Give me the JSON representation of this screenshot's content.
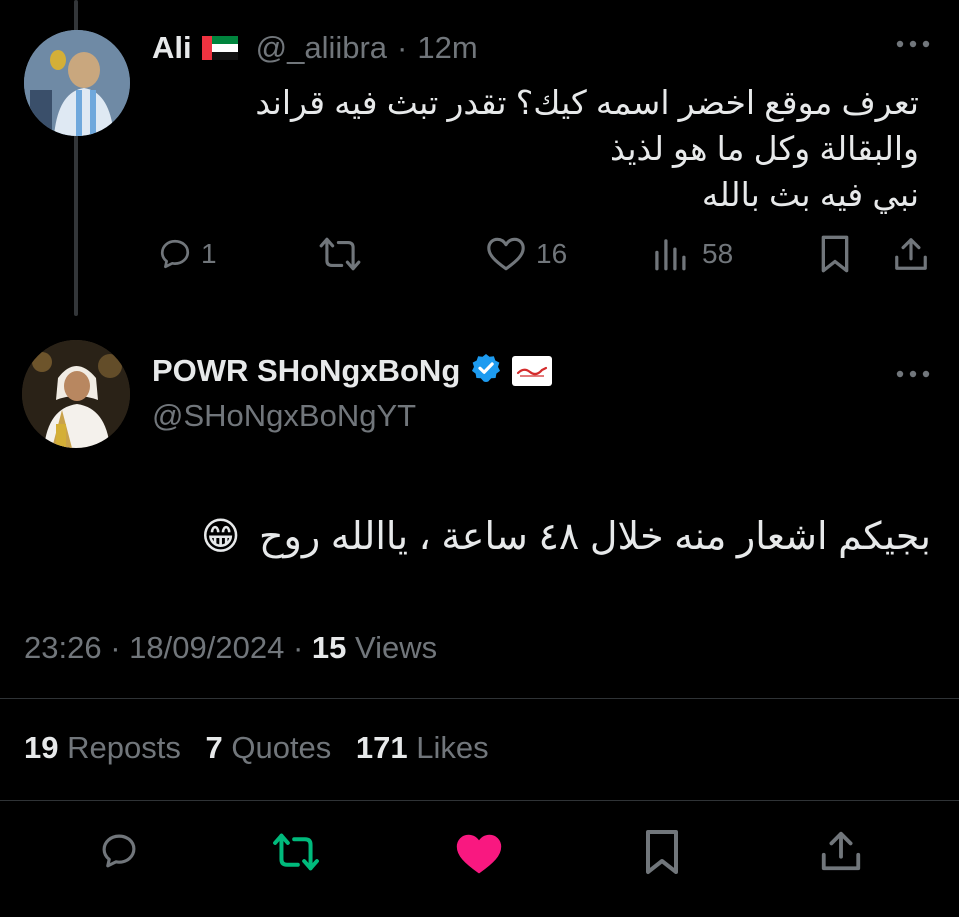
{
  "reply_to_tweet": {
    "display_name": "Ali",
    "flag": "uae-flag-emoji",
    "handle": "@_aliibra",
    "separator": "·",
    "time": "12m",
    "text_lines": [
      "تعرف موقع اخضر اسمه كيك؟ تقدر تبث فيه قراند",
      "والبقالة وكل ما هو لذيذ",
      "نبي فيه بث بالله"
    ],
    "actions": {
      "replies": "1",
      "likes": "16",
      "views": "58"
    }
  },
  "main_tweet": {
    "display_name": "POWR SHoNgxBoNg",
    "handle": "@SHoNgxBoNgYT",
    "text": "بجيكم اشعار منه خلال ٤٨ ساعة ، ياالله روح",
    "emoji": "😁",
    "time": "23:26",
    "date": "18/09/2024",
    "separator": "·",
    "views_count": "15",
    "views_label": "Views",
    "reposts_count": "19",
    "reposts_label": "Reposts",
    "quotes_count": "7",
    "quotes_label": "Quotes",
    "likes_count": "171",
    "likes_label": "Likes"
  },
  "icons": {
    "reply": "reply-icon",
    "repost": "repost-icon",
    "like": "heart-icon",
    "views": "views-icon",
    "bookmark": "bookmark-icon",
    "share": "share-icon",
    "more": "more-icon",
    "verified": "verified-badge-icon"
  },
  "colors": {
    "background": "#000000",
    "text": "#e7e9ea",
    "muted": "#71767b",
    "verified": "#1d9bf0",
    "repost_active": "#00ba7c",
    "like_active": "#f91880",
    "divider": "#2f3336"
  }
}
